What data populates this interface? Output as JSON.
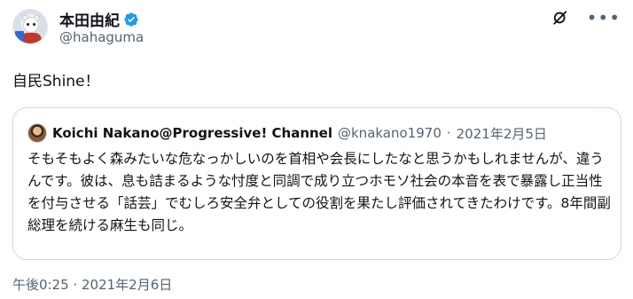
{
  "author": {
    "display_name": "本田由紀",
    "handle": "@hahaguma",
    "verified": true
  },
  "icons": {
    "avatar": "profile-photo-bear",
    "verified": "verified-badge-icon",
    "grok": "grok-icon",
    "more": "more-icon",
    "quoted_avatar": "quoted-profile-photo"
  },
  "colors": {
    "verified_badge": "#1d9bf0",
    "secondary_text": "#536471",
    "border": "#cfd9de"
  },
  "tweet": {
    "text": "自民Shine！"
  },
  "quoted": {
    "display_name": "Koichi Nakano@Progressive! Channel",
    "handle": "@knakano1970",
    "separator": "·",
    "date": "2021年2月5日",
    "text": "そもそもよく森みたいな危なっかしいのを首相や会長にしたなと思うかもしれませんが、違うんです。彼は、息も詰まるような忖度と同調で成り立つホモソ社会の本音を表で暴露し正当性を付与させる「話芸」でむしろ安全弁としての役割を果たし評価されてきたわけです。8年間副総理を続ける麻生も同じ。"
  },
  "timestamp": "午後0:25 · 2021年2月6日"
}
